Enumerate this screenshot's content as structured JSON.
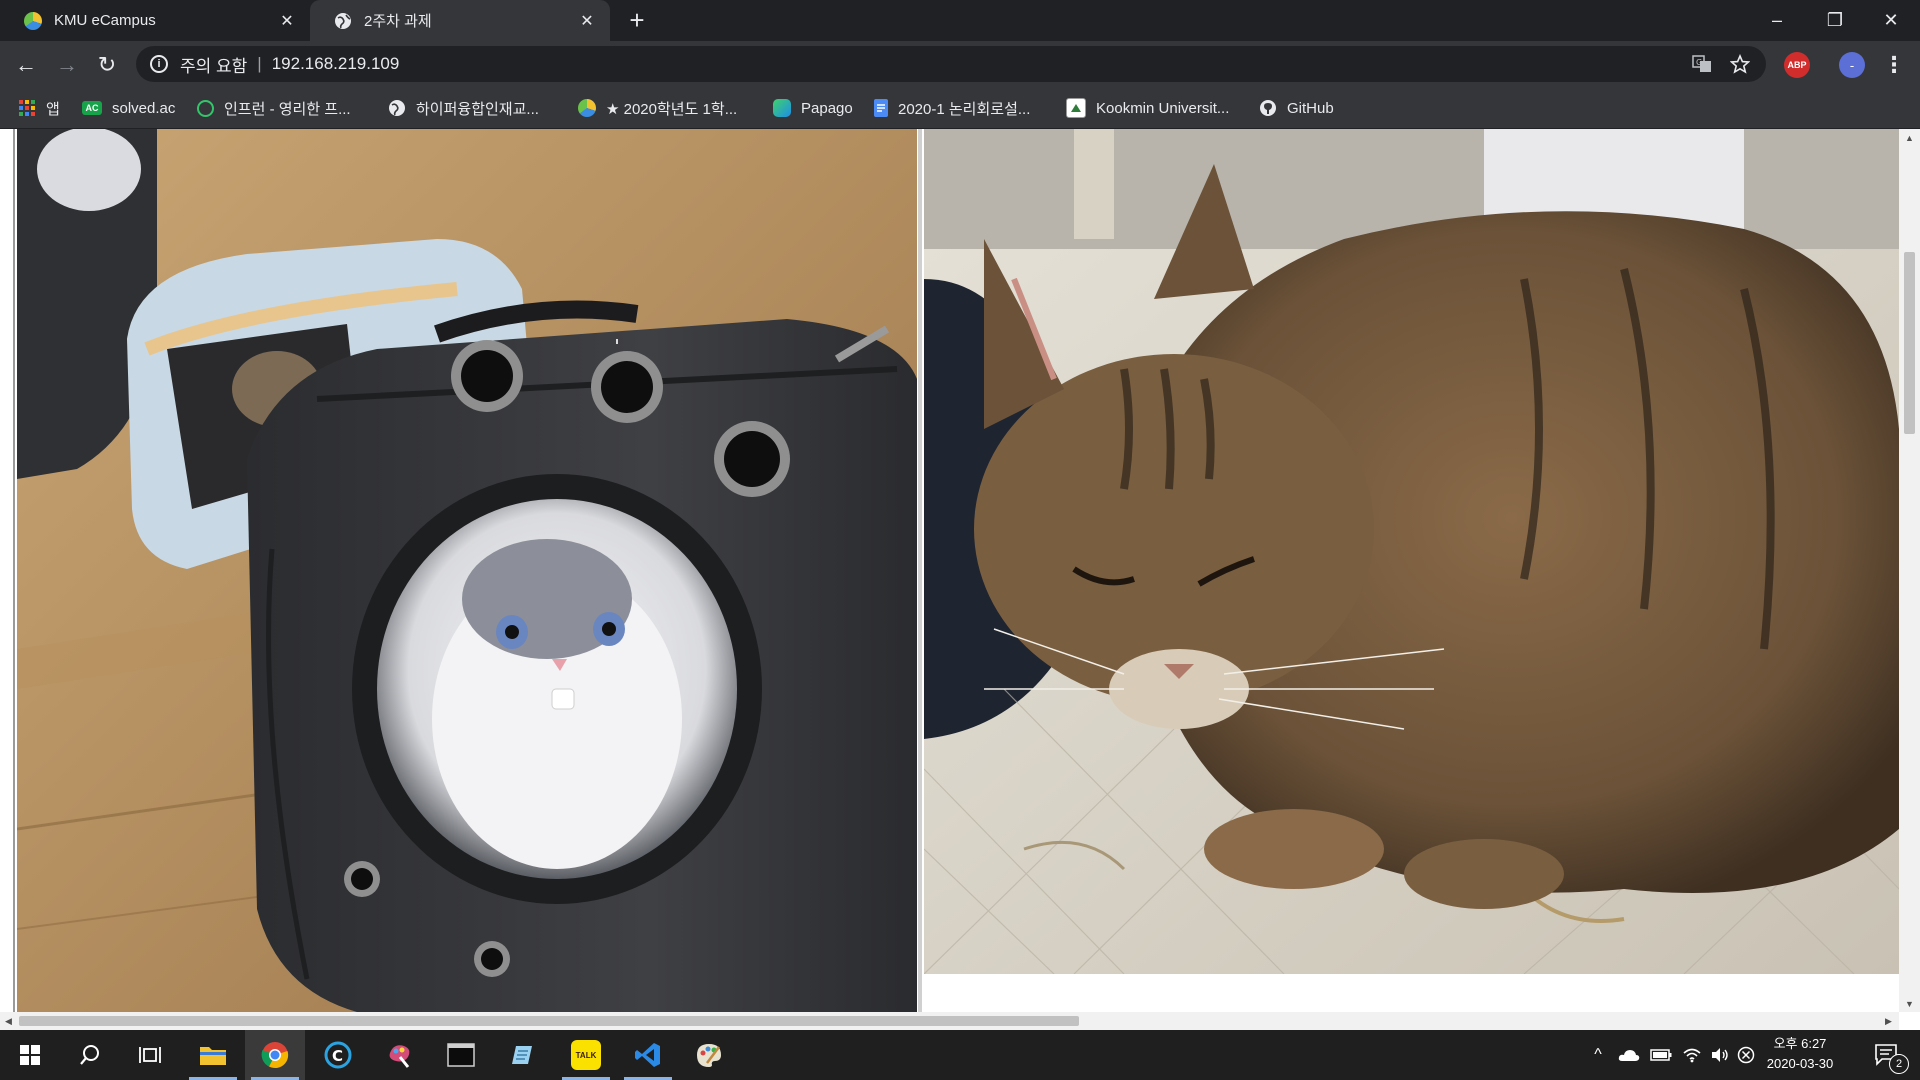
{
  "browser": {
    "tabs": [
      {
        "title": "KMU eCampus",
        "active": false
      },
      {
        "title": "2주차 과제",
        "active": true
      }
    ],
    "new_tab_label": "+",
    "window_controls": {
      "minimize": "–",
      "restore": "❐",
      "close": "✕"
    },
    "toolbar": {
      "back": "←",
      "forward": "→",
      "reload": "↻",
      "security_info_glyph": "i",
      "security_label": "주의 요함",
      "separator": "|",
      "url": "192.168.219.109",
      "abp_label": "ABP",
      "profile_initial": "-",
      "menu_glyph": "⋮"
    },
    "bookmarks": [
      {
        "label": "앱",
        "icon": "apps-grid-icon"
      },
      {
        "label": "solved.ac",
        "icon": "solved-ac-icon",
        "icon_text": "AC"
      },
      {
        "label": "인프런 - 영리한 프...",
        "icon": "inflearn-icon"
      },
      {
        "label": "하이퍼융합인재교...",
        "icon": "globe-icon"
      },
      {
        "label": "★ 2020학년도 1학...",
        "icon": "ecampus-icon"
      },
      {
        "label": "Papago",
        "icon": "papago-icon"
      },
      {
        "label": "2020-1 논리회로설...",
        "icon": "docs-icon"
      },
      {
        "label": "Kookmin Universit...",
        "icon": "kookmin-icon"
      },
      {
        "label": "GitHub",
        "icon": "github-icon"
      }
    ]
  },
  "page": {
    "images": [
      {
        "name": "white cat in a bubble pet carrier backpack"
      },
      {
        "name": "tabby cat loafing on a quilted blanket"
      }
    ],
    "scrollbars": {
      "up": "▲",
      "down": "▼",
      "left": "◀",
      "right": "▶"
    }
  },
  "taskbar": {
    "apps": [
      "start",
      "search",
      "task-view",
      "file-explorer",
      "chrome",
      "cortana-c",
      "paint-3d",
      "terminal",
      "notepad",
      "kakaotalk",
      "vscode",
      "paint"
    ],
    "kakao_label": "TALK",
    "clock": {
      "ampm_time": "오후 6:27",
      "date": "2020-03-30"
    },
    "notification_count": "2",
    "tray_chevron": "^"
  },
  "colors": {
    "tab_strip": "#202124",
    "toolbar": "#35363a",
    "taskbar": "#1f1f1f",
    "accent": "#8cb3e6"
  }
}
